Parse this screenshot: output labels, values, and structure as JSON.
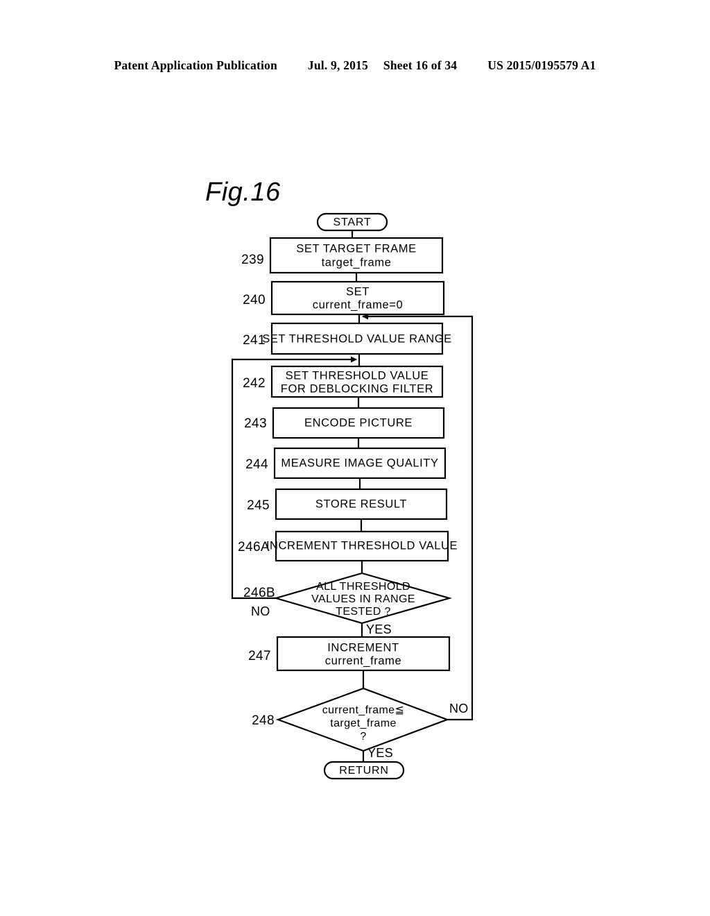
{
  "header": {
    "publication": "Patent Application Publication",
    "date": "Jul. 9, 2015",
    "sheet": "Sheet 16 of 34",
    "patent_number": "US 2015/0195579 A1"
  },
  "figure": {
    "label": "Fig.16"
  },
  "flowchart": {
    "start_label": "START",
    "return_label": "RETURN",
    "steps": [
      {
        "ref": "239",
        "line1": "SET TARGET FRAME",
        "line2": "target_frame"
      },
      {
        "ref": "240",
        "line1": "SET",
        "line2": "current_frame=0"
      },
      {
        "ref": "241",
        "line1": "SET THRESHOLD VALUE RANGE",
        "line2": ""
      },
      {
        "ref": "242",
        "line1": "SET THRESHOLD VALUE",
        "line2": "FOR DEBLOCKING FILTER"
      },
      {
        "ref": "243",
        "line1": "ENCODE PICTURE",
        "line2": ""
      },
      {
        "ref": "244",
        "line1": "MEASURE IMAGE QUALITY",
        "line2": ""
      },
      {
        "ref": "245",
        "line1": "STORE RESULT",
        "line2": ""
      },
      {
        "ref": "246A",
        "line1": "INCREMENT THRESHOLD VALUE",
        "line2": ""
      },
      {
        "ref": "247",
        "line1": "INCREMENT",
        "line2": "current_frame"
      }
    ],
    "decisions": [
      {
        "ref": "246B",
        "line1": "ALL THRESHOLD",
        "line2": "VALUES IN RANGE",
        "line3": "TESTED ?",
        "no_label": "NO",
        "yes_label": "YES"
      },
      {
        "ref": "248",
        "line1": "current_frame≦",
        "line2": "target_frame",
        "line3": "?",
        "no_label": "NO",
        "yes_label": "YES"
      }
    ]
  },
  "colors": {
    "ink": "#000000",
    "paper": "#ffffff"
  }
}
